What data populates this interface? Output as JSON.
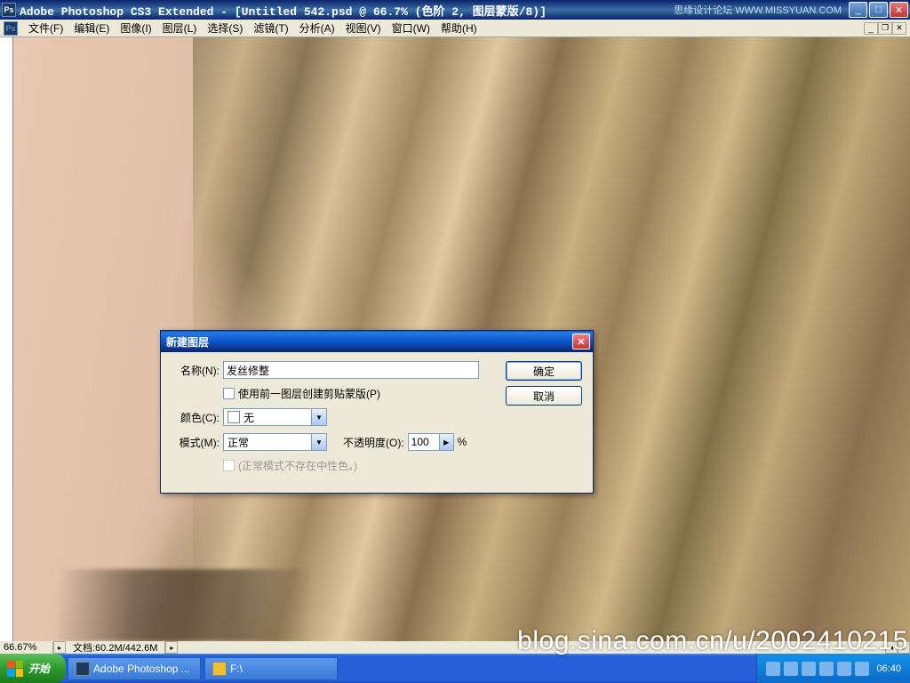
{
  "title": "Adobe Photoshop CS3 Extended - [Untitled 542.psd @ 66.7% (色阶 2, 图层蒙版/8)]",
  "watermark_tr": "思缘设计论坛  WWW.MISSYUAN.COM",
  "menu": {
    "file": "文件(F)",
    "edit": "编辑(E)",
    "image": "图像(I)",
    "layer": "图层(L)",
    "select": "选择(S)",
    "filter": "滤镜(T)",
    "analysis": "分析(A)",
    "view": "视图(V)",
    "window": "窗口(W)",
    "help": "帮助(H)"
  },
  "status": {
    "zoom": "66.67%",
    "doc": "文档:60.2M/442.6M"
  },
  "dialog": {
    "title": "新建图层",
    "name_label": "名称(N):",
    "name_value": "发丝修整",
    "clip_label": "使用前一图层创建剪贴蒙版(P)",
    "color_label": "颜色(C):",
    "color_value": "无",
    "mode_label": "模式(M):",
    "mode_value": "正常",
    "opacity_label": "不透明度(O):",
    "opacity_value": "100",
    "opacity_pct": "%",
    "neutral_label": "(正常模式不存在中性色。)",
    "ok": "确定",
    "cancel": "取消"
  },
  "taskbar": {
    "start": "开始",
    "task_ps": "Adobe Photoshop ...",
    "task_folder": "F:\\",
    "time": "06:40"
  },
  "blog_watermark": "blog.sina.com.cn/u/2002410215"
}
